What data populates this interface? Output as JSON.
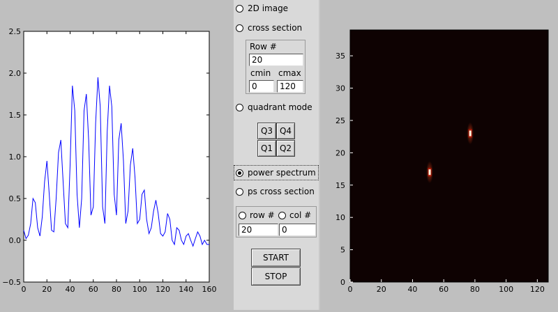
{
  "modes": {
    "image_2d": "2D image",
    "cross_section": "cross section",
    "quadrant_mode": "quadrant mode",
    "power_spectrum": "power spectrum",
    "ps_cross_section": "ps cross section",
    "selected": "power_spectrum"
  },
  "cross_section_box": {
    "row_label": "Row #",
    "row_value": "20",
    "cmin_label": "cmin",
    "cmax_label": "cmax",
    "cmin_value": "0",
    "cmax_value": "120"
  },
  "quadrants": {
    "q1": "Q1",
    "q2": "Q2",
    "q3": "Q3",
    "q4": "Q4"
  },
  "ps_box": {
    "row_label": "row #",
    "col_label": "col #",
    "selected": "row",
    "row_value": "20",
    "col_value": "0"
  },
  "buttons": {
    "start": "START",
    "stop": "STOP"
  },
  "chart_data": [
    {
      "type": "line",
      "title": "",
      "xlabel": "",
      "ylabel": "",
      "xlim": [
        0,
        160
      ],
      "ylim": [
        -0.5,
        2.5
      ],
      "xticks": [
        0,
        20,
        40,
        60,
        80,
        100,
        120,
        140,
        160
      ],
      "yticks": [
        -0.5,
        0.0,
        0.5,
        1.0,
        1.5,
        2.0,
        2.5
      ],
      "xtick_labels": [
        "0",
        "20",
        "40",
        "60",
        "80",
        "100",
        "120",
        "140",
        "160"
      ],
      "ytick_labels": [
        "−0.5",
        "0.0",
        "0.5",
        "1.0",
        "1.5",
        "2.0",
        "2.5"
      ],
      "color": "#0000ff",
      "series": [
        {
          "x": [
            0,
            2,
            4,
            6,
            8,
            10,
            12,
            14,
            16,
            18,
            20,
            22,
            24,
            26,
            28,
            30,
            32,
            34,
            36,
            38,
            40,
            42,
            44,
            46,
            48,
            50,
            52,
            54,
            56,
            58,
            60,
            62,
            64,
            66,
            68,
            70,
            72,
            74,
            76,
            78,
            80,
            82,
            84,
            86,
            88,
            90,
            92,
            94,
            96,
            98,
            100,
            102,
            104,
            106,
            108,
            110,
            112,
            114,
            116,
            118,
            120,
            122,
            124,
            126,
            128,
            130,
            132,
            134,
            136,
            138,
            140,
            142,
            144,
            146,
            148,
            150,
            152,
            154,
            156,
            158,
            160
          ],
          "y": [
            0.12,
            0.02,
            0.06,
            0.2,
            0.5,
            0.45,
            0.15,
            0.05,
            0.28,
            0.7,
            0.95,
            0.55,
            0.12,
            0.1,
            0.5,
            1.05,
            1.2,
            0.7,
            0.2,
            0.15,
            0.9,
            1.85,
            1.55,
            0.55,
            0.15,
            0.5,
            1.55,
            1.75,
            1.2,
            0.3,
            0.4,
            1.4,
            1.95,
            1.6,
            0.4,
            0.2,
            1.3,
            1.85,
            1.6,
            0.55,
            0.3,
            1.2,
            1.4,
            0.95,
            0.2,
            0.35,
            0.9,
            1.1,
            0.75,
            0.2,
            0.25,
            0.55,
            0.6,
            0.25,
            0.08,
            0.15,
            0.35,
            0.48,
            0.32,
            0.08,
            0.05,
            0.1,
            0.32,
            0.25,
            0.0,
            -0.05,
            0.15,
            0.12,
            0.0,
            -0.05,
            0.05,
            0.08,
            0.0,
            -0.07,
            0.02,
            0.1,
            0.05,
            -0.05,
            0.0,
            -0.05,
            -0.05
          ]
        }
      ]
    },
    {
      "type": "heatmap",
      "title": "",
      "xlabel": "",
      "ylabel": "",
      "xlim": [
        0,
        127
      ],
      "ylim": [
        0,
        39
      ],
      "xticks": [
        0,
        20,
        40,
        60,
        80,
        100,
        120
      ],
      "yticks": [
        0,
        5,
        10,
        15,
        20,
        25,
        30,
        35
      ],
      "xtick_labels": [
        "0",
        "20",
        "40",
        "60",
        "80",
        "100",
        "120"
      ],
      "ytick_labels": [
        "0",
        "5",
        "10",
        "15",
        "20",
        "25",
        "30",
        "35"
      ],
      "background_color": "#0e0202",
      "peaks": [
        {
          "x": 51,
          "y": 17,
          "intensity": 1.0
        },
        {
          "x": 77,
          "y": 23,
          "intensity": 1.0
        }
      ]
    }
  ]
}
